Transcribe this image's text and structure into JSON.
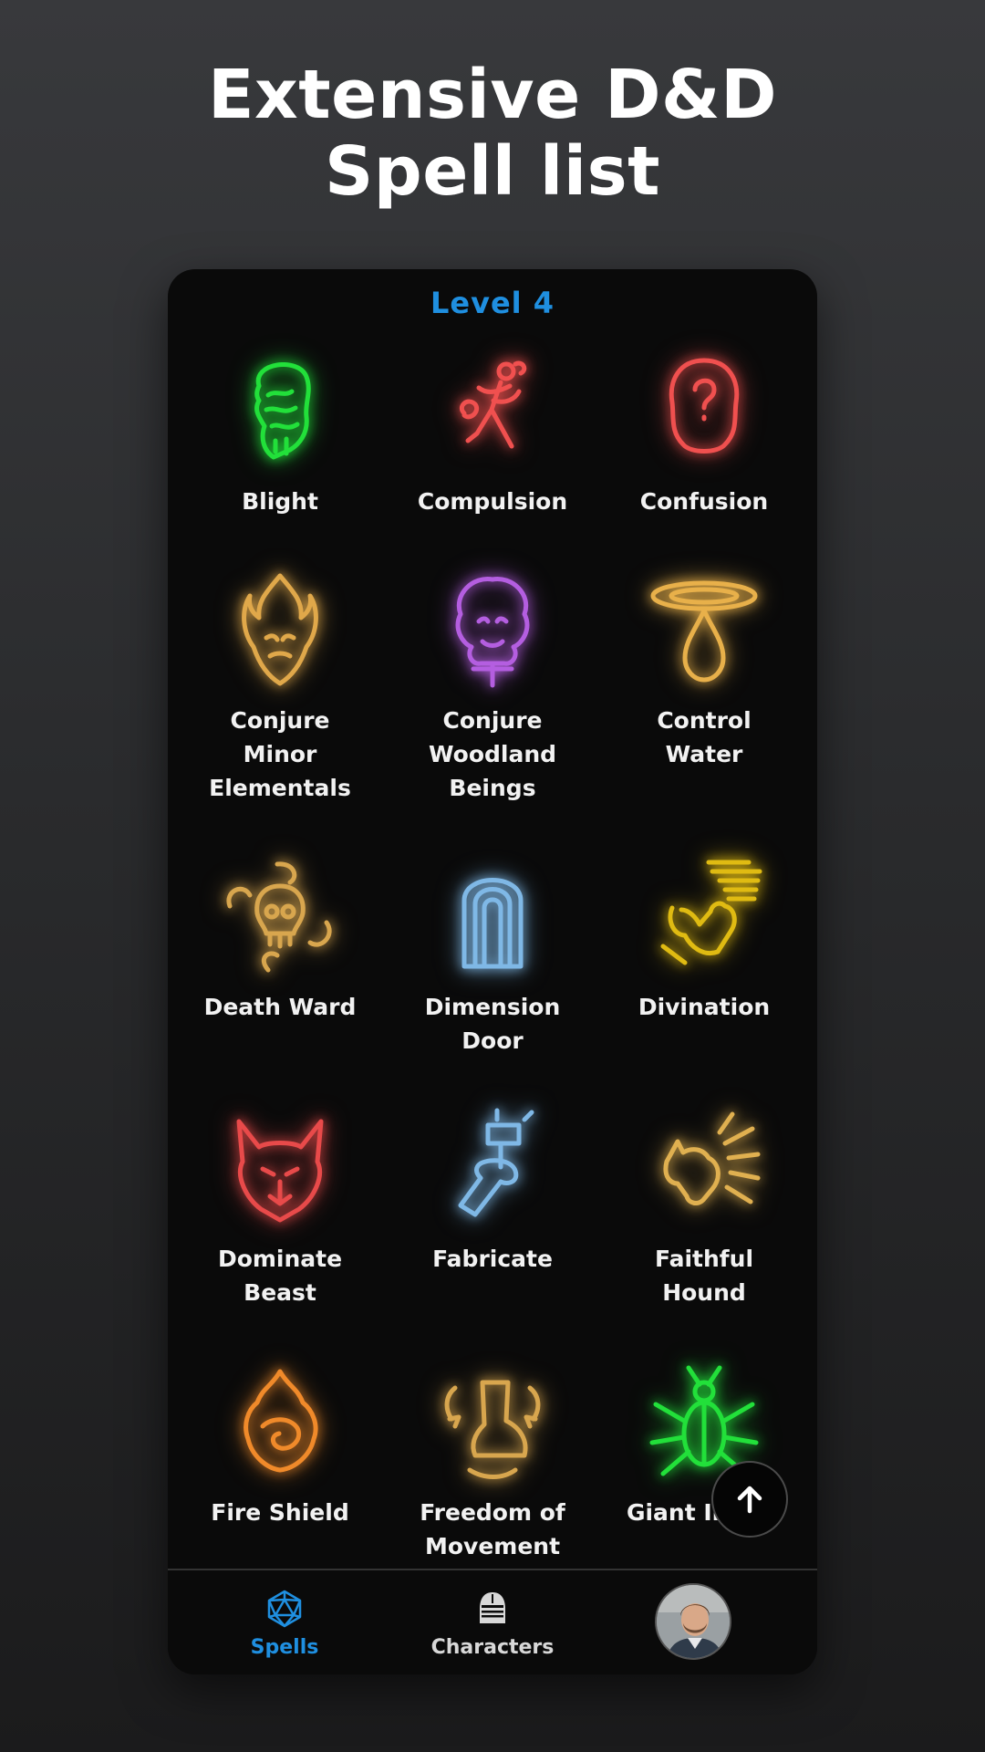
{
  "header": {
    "line1": "Extensive D&D",
    "line2": "Spell list"
  },
  "level_title": "Level 4",
  "spells": [
    {
      "name_lines": [
        "Blight"
      ],
      "icon": "rotting-hand-icon",
      "color": "#22e03a"
    },
    {
      "name_lines": [
        "Compulsion"
      ],
      "icon": "dancing-figure-icon",
      "color": "#f0504f"
    },
    {
      "name_lines": [
        "Confusion"
      ],
      "icon": "question-head-icon",
      "color": "#f0504f"
    },
    {
      "name_lines": [
        "Conjure",
        "Minor",
        "Elementals"
      ],
      "icon": "flame-spirit-icon",
      "color": "#e0a84a"
    },
    {
      "name_lines": [
        "Conjure",
        "Woodland",
        "Beings"
      ],
      "icon": "dryad-face-icon",
      "color": "#b45ee0"
    },
    {
      "name_lines": [
        "Control",
        "Water"
      ],
      "icon": "water-drop-icon",
      "color": "#e8b04a"
    },
    {
      "name_lines": [
        "Death Ward"
      ],
      "icon": "skull-ward-icon",
      "color": "#d8a64e"
    },
    {
      "name_lines": [
        "Dimension",
        "Door"
      ],
      "icon": "arch-door-icon",
      "color": "#7fb8e6"
    },
    {
      "name_lines": [
        "Divination"
      ],
      "icon": "divining-hand-icon",
      "color": "#e0bb12"
    },
    {
      "name_lines": [
        "Dominate",
        "Beast"
      ],
      "icon": "wolf-head-icon",
      "color": "#e84a4a"
    },
    {
      "name_lines": [
        "Fabricate"
      ],
      "icon": "hammer-hand-icon",
      "color": "#7fb8e6"
    },
    {
      "name_lines": [
        "Faithful",
        "Hound"
      ],
      "icon": "barking-hound-icon",
      "color": "#e0b050"
    },
    {
      "name_lines": [
        "Fire Shield"
      ],
      "icon": "fire-swirl-icon",
      "color": "#f08a2a"
    },
    {
      "name_lines": [
        "Freedom of",
        "Movement"
      ],
      "icon": "boot-arrows-icon",
      "color": "#d8a64e"
    },
    {
      "name_lines": [
        "Giant Insect"
      ],
      "icon": "giant-insect-icon",
      "color": "#22e03a"
    }
  ],
  "nav": {
    "spells_label": "Spells",
    "characters_label": "Characters",
    "active_color": "#1f8fe0",
    "inactive_color": "#d8d8d8"
  }
}
